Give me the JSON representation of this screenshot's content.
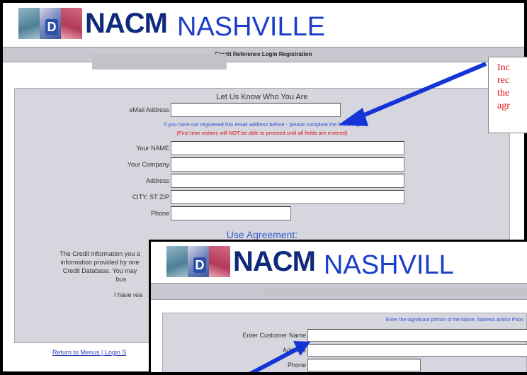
{
  "screenshot1": {
    "logo_letter": "D",
    "brand": "NACM",
    "city": "NASHVILLE",
    "title": "Credit Reference Login Registration",
    "section_title": "Let Us Know Who You Are",
    "email_label": "eMail Address",
    "note_blue": "If you have not registered this email address before - please complete the following:",
    "note_red": "(First time visitors will NOT be able to proceed until all fields are entered)",
    "fields": [
      {
        "label": "Your NAME"
      },
      {
        "label": "Your Company"
      },
      {
        "label": "Address"
      },
      {
        "label": "CITY, ST ZIP"
      },
      {
        "label": "Phone"
      }
    ],
    "use_agreement": "Use Agreement:",
    "agreement_text": "The Credit information you a... information provided by one... Credit Database. You may... bus...",
    "agreement_line1": "The Credit information you a",
    "agreement_line2": "information provided by one",
    "agreement_line3": "Credit Database. You may",
    "agreement_line4": "bus",
    "agreement_line5": "I have rea",
    "footer_links": "Return to Menus  |  Login S"
  },
  "callout": {
    "lines": [
      "Inc",
      "rec",
      "the",
      "agr"
    ]
  },
  "screenshot2": {
    "brand": "NACM",
    "city": "NASHVILL",
    "hint": "Enter the significant portion of the Name, Address and/or Phon",
    "fields": [
      {
        "label": "Enter Customer Name"
      },
      {
        "label": "Address"
      },
      {
        "label": "Phone"
      }
    ]
  },
  "colors": {
    "brand": "#0f2a7a",
    "city": "#1a3ec9",
    "arrow": "#1434d6",
    "note_red": "#dd1111",
    "form_bg": "#d6d6de"
  }
}
